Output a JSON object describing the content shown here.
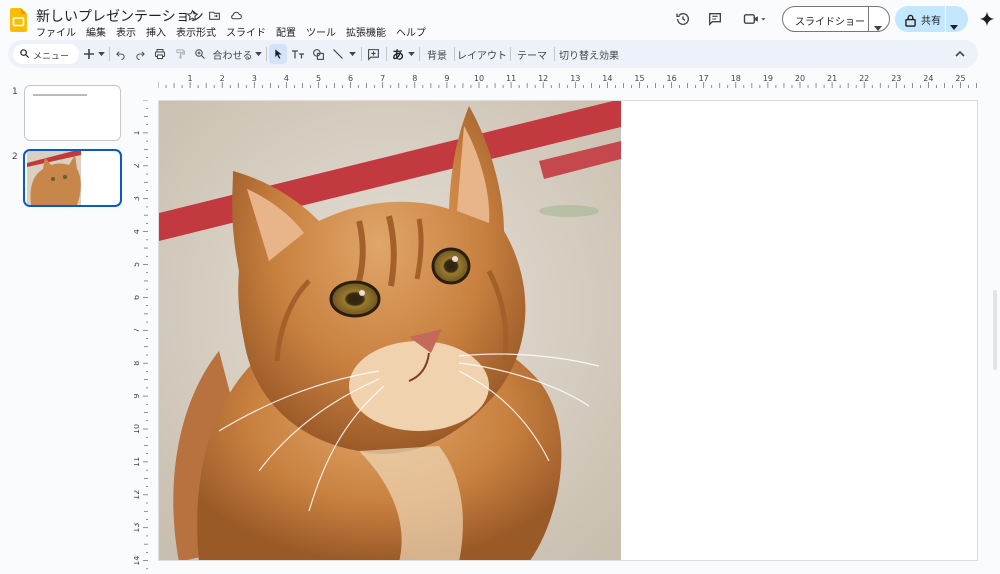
{
  "app": {
    "title": "新しいプレゼンテーション"
  },
  "menu": [
    "ファイル",
    "編集",
    "表示",
    "挿入",
    "表示形式",
    "スライド",
    "配置",
    "ツール",
    "拡張機能",
    "ヘルプ"
  ],
  "header": {
    "slideshow_label": "スライドショー",
    "share_label": "共有"
  },
  "toolbar": {
    "search_label": "メニュー",
    "zoom_label": "合わせる",
    "font_glyph": "あ",
    "background_label": "背景",
    "layout_label": "レイアウト",
    "theme_label": "テーマ",
    "transition_label": "切り替え効果"
  },
  "slides": [
    {
      "number": "1"
    },
    {
      "number": "2"
    }
  ],
  "rulers": {
    "horizontal": [
      "1",
      "2",
      "3",
      "4",
      "5",
      "6",
      "7",
      "8",
      "9",
      "10",
      "11",
      "12",
      "13",
      "14",
      "15",
      "16",
      "17",
      "18",
      "19",
      "20",
      "21",
      "22",
      "23",
      "24",
      "25"
    ],
    "vertical": [
      "1",
      "2",
      "3",
      "4",
      "5",
      "6",
      "7",
      "8",
      "9",
      "10",
      "11",
      "12",
      "13",
      "14"
    ]
  },
  "colors": {
    "accent": "#0b57d0",
    "share_bg": "#c2e7ff",
    "toolbar_bg": "#edf2fa",
    "logo": "#fbbc04"
  }
}
